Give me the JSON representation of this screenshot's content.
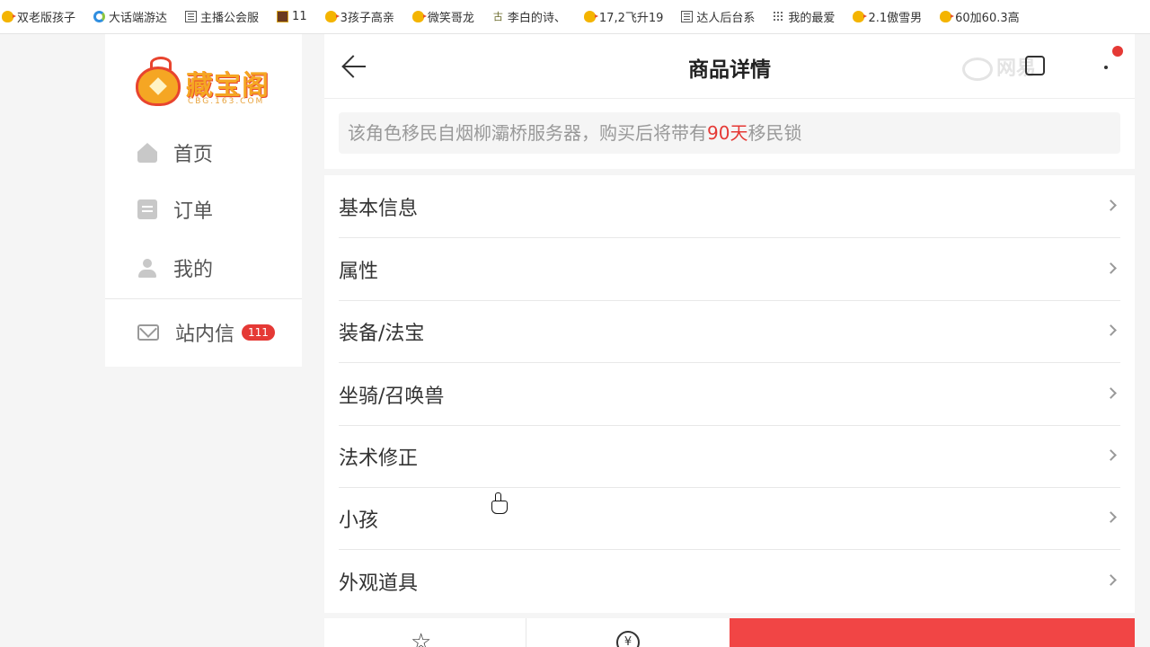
{
  "bookmarks": [
    {
      "label": "双老版孩子",
      "icon": "chick-icon"
    },
    {
      "label": "大话端游达",
      "icon": "browser-e-icon"
    },
    {
      "label": "主播公会服",
      "icon": "document-icon"
    },
    {
      "label": "11",
      "icon": "game-icon"
    },
    {
      "label": "3孩子高亲",
      "icon": "chick-icon"
    },
    {
      "label": "微笑哥龙",
      "icon": "chick-icon"
    },
    {
      "label": "李白的诗、",
      "icon": "gu-icon"
    },
    {
      "label": "17,2飞升19",
      "icon": "chick-icon"
    },
    {
      "label": "达人后台系",
      "icon": "document-icon"
    },
    {
      "label": "我的最爱",
      "icon": "grid-icon"
    },
    {
      "label": "2.1傲雪男",
      "icon": "chick-icon"
    },
    {
      "label": "60加60.3高",
      "icon": "chick-icon"
    }
  ],
  "sidebar": {
    "logo_text": "藏宝阁",
    "logo_sub": "CBG.163.COM",
    "nav": [
      {
        "label": "首页",
        "icon": "home-icon"
      },
      {
        "label": "订单",
        "icon": "order-icon"
      },
      {
        "label": "我的",
        "icon": "user-icon"
      }
    ],
    "mail": {
      "label": "站内信",
      "icon": "mail-icon",
      "badge": "111"
    }
  },
  "header": {
    "title": "商品详情",
    "watermark": "网易"
  },
  "notice": {
    "prefix": "该角色移民自烟柳灞桥服务器，购买后将带有",
    "highlight": "90天",
    "suffix": "移民锁"
  },
  "sections": [
    "基本信息",
    "属性",
    "装备/法宝",
    "坐骑/召唤兽",
    "法术修正",
    "小孩",
    "外观道具"
  ],
  "bottom_bar": {
    "favorite_icon": "star-icon",
    "price_icon": "yen-icon"
  },
  "colors": {
    "accent": "#f14545",
    "highlight": "#e53935",
    "logo": "#f5a623"
  }
}
